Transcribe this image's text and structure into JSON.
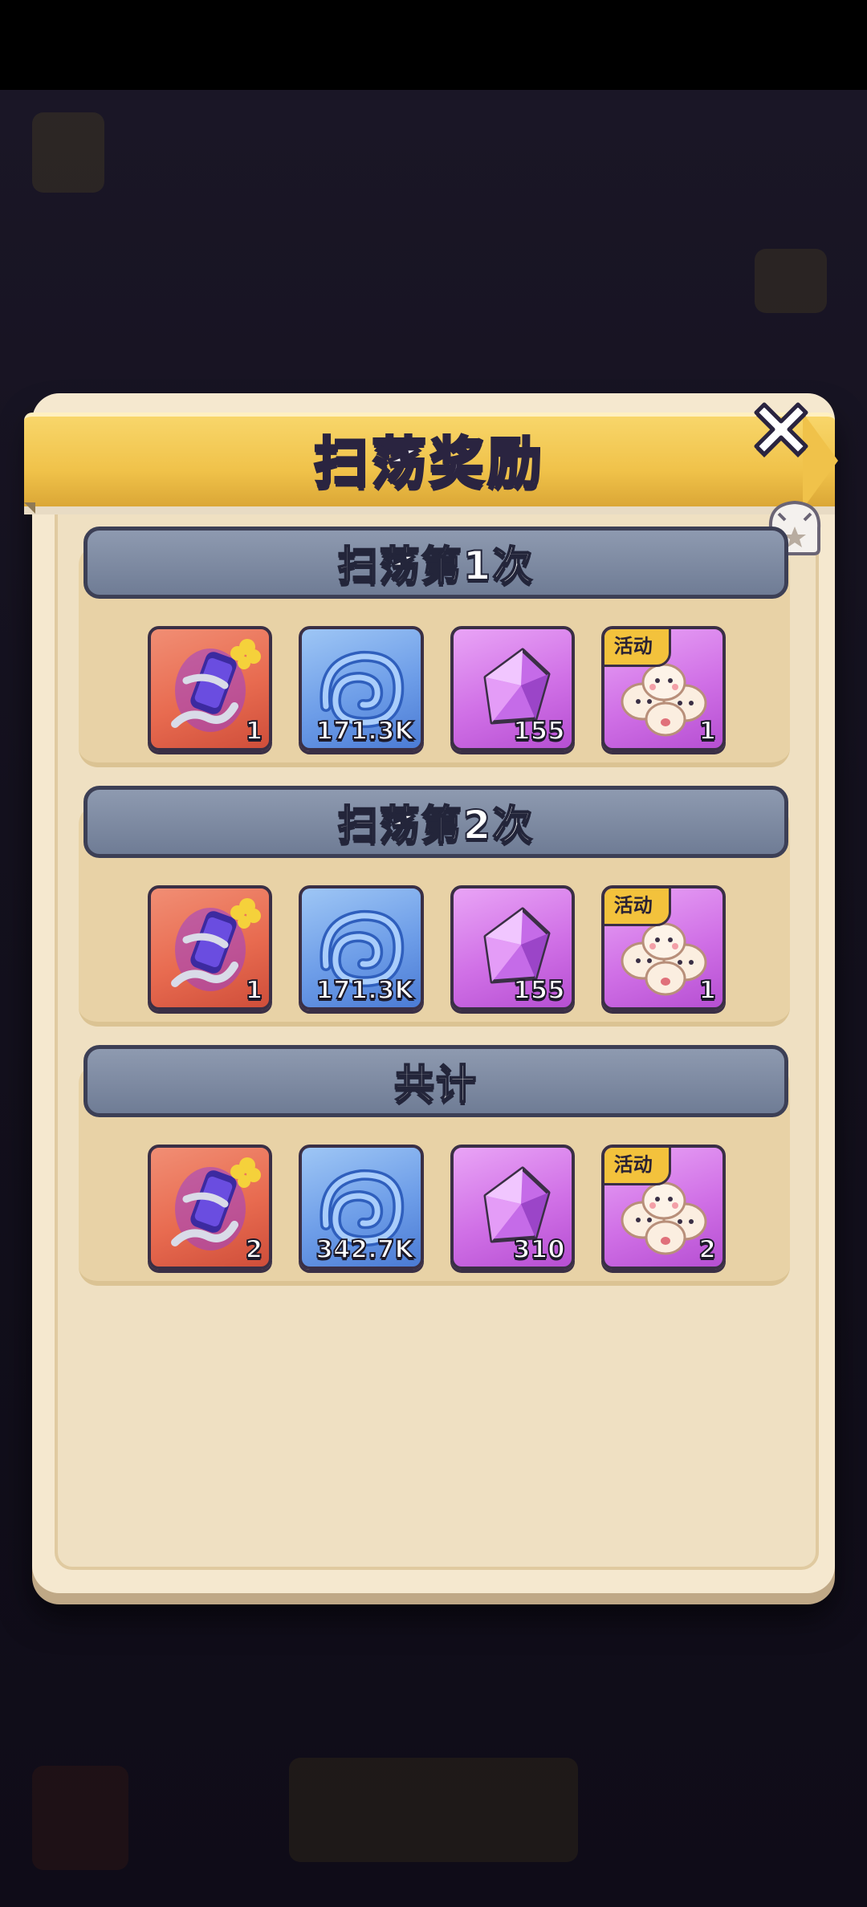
{
  "dialog": {
    "title": "扫荡奖励"
  },
  "sections": [
    {
      "header": "扫荡第1次",
      "items": [
        {
          "icon": "scroll-icon",
          "quantity": "1"
        },
        {
          "icon": "blue-swirl-icon",
          "quantity": "171.3K"
        },
        {
          "icon": "purple-gem-icon",
          "quantity": "155"
        },
        {
          "icon": "dumplings-icon",
          "quantity": "1",
          "tag": "活动"
        }
      ]
    },
    {
      "header": "扫荡第2次",
      "items": [
        {
          "icon": "scroll-icon",
          "quantity": "1"
        },
        {
          "icon": "blue-swirl-icon",
          "quantity": "171.3K"
        },
        {
          "icon": "purple-gem-icon",
          "quantity": "155"
        },
        {
          "icon": "dumplings-icon",
          "quantity": "1",
          "tag": "活动"
        }
      ]
    },
    {
      "header": "共计",
      "items": [
        {
          "icon": "scroll-icon",
          "quantity": "2"
        },
        {
          "icon": "blue-swirl-icon",
          "quantity": "342.7K"
        },
        {
          "icon": "purple-gem-icon",
          "quantity": "310"
        },
        {
          "icon": "dumplings-icon",
          "quantity": "2",
          "tag": "活动"
        }
      ]
    }
  ],
  "colors": {
    "banner": "#f0c24a",
    "panel": "#f5e8cf",
    "section_header": "#6f7c95",
    "item_red": "#e86b50",
    "item_blue": "#6d9de8",
    "item_purple": "#d070e6",
    "tag": "#f3c23c"
  }
}
